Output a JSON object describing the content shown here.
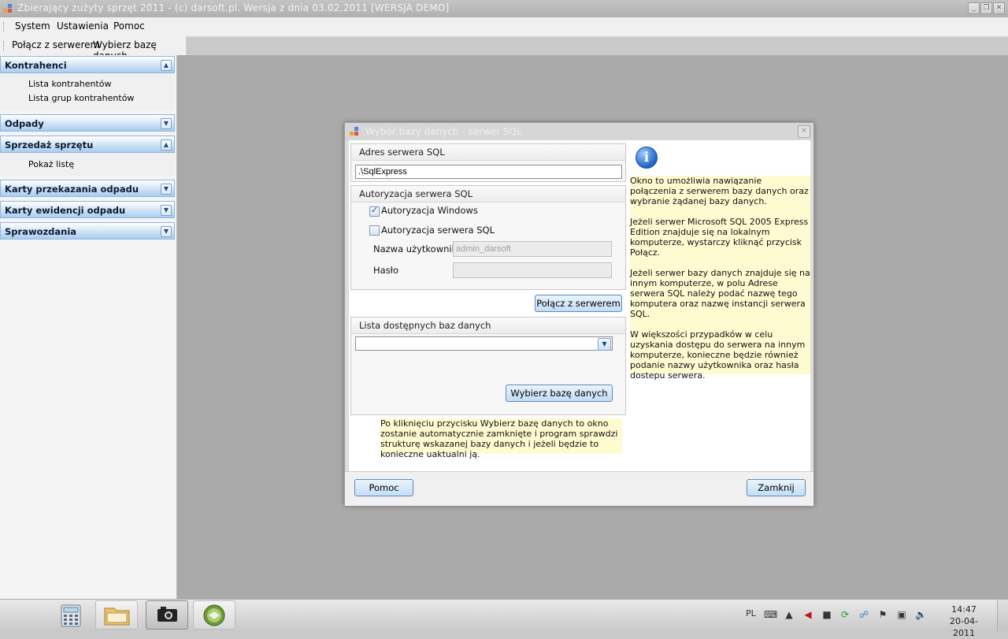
{
  "window": {
    "title": "Zbierający zużyty sprzęt 2011 - (c) darsoft.pl. Wersja z dnia 03.02.2011 [WERSJA DEMO]"
  },
  "menu": [
    "System",
    "Ustawienia",
    "Pomoc"
  ],
  "toolbar": {
    "connect": "Połącz z serwerem",
    "select_db": "Wybierz bazę danych"
  },
  "sidebar": {
    "sections": [
      {
        "label": "Kontrahenci",
        "expanded": true,
        "items": [
          "Lista kontrahentów",
          "Lista grup kontrahentów"
        ]
      },
      {
        "label": "Odpady",
        "expanded": false,
        "items": []
      },
      {
        "label": "Sprzedaż sprzętu",
        "expanded": true,
        "items": [
          "Pokaż listę"
        ]
      },
      {
        "label": "Karty przekazania odpadu",
        "expanded": false,
        "items": []
      },
      {
        "label": "Karty ewidencji odpadu",
        "expanded": false,
        "items": []
      },
      {
        "label": "Sprawozdania",
        "expanded": false,
        "items": []
      }
    ]
  },
  "dialog": {
    "title": "Wybór bazy danych - serwer SQL",
    "server_group": {
      "label": "Adres serwera SQL",
      "value": ".\\SqlExpress"
    },
    "auth_group": {
      "label": "Autoryzacja serwera SQL",
      "windows_auth": {
        "label": "Autoryzacja Windows",
        "checked": true
      },
      "sql_auth": {
        "label": "Autoryzacja serwera SQL",
        "checked": false
      },
      "username_label": "Nazwa użytkownika",
      "username_value": "admin_darsoft",
      "password_label": "Hasło",
      "password_value": ""
    },
    "connect_button": "Połącz z serwerem",
    "db_group": {
      "label": "Lista dostępnych baz danych",
      "selected": ""
    },
    "select_button": "Wybierz bazę danych",
    "bottom_note": "Po kliknięciu przycisku Wybierz bazę danych to okno zostanie automatycznie zamknięte i program sprawdzi strukturę wskazanej bazy danych i jeżeli będzie to konieczne uaktualni ją.",
    "info": [
      "Okno to umożliwia nawiązanie połączenia z serwerem bazy danych oraz wybranie żądanej bazy danych.",
      "Jeżeli serwer Microsoft SQL 2005 Express Edition znajduje się na lokalnym komputerze, wystarczy kliknąć przycisk Połącz.",
      "Jeżeli serwer bazy danych znajduje się na innym komputerze, w polu Adrese serwera SQL należy podać nazwę tego komputera oraz nazwę instancji serwera SQL.",
      "W większości przypadków w celu uzyskania dostępu do serwera na innym komputerze, konieczne będzie również podanie nazwy użytkownika oraz hasła dostepu serwera."
    ],
    "help_button": "Pomoc",
    "close_button": "Zamknij"
  },
  "taskbar": {
    "apps": [
      "calculator-icon",
      "folder-icon",
      "camera-icon",
      "app-icon"
    ],
    "language": "PL",
    "time": "14:47",
    "date": "20-04-2011"
  }
}
